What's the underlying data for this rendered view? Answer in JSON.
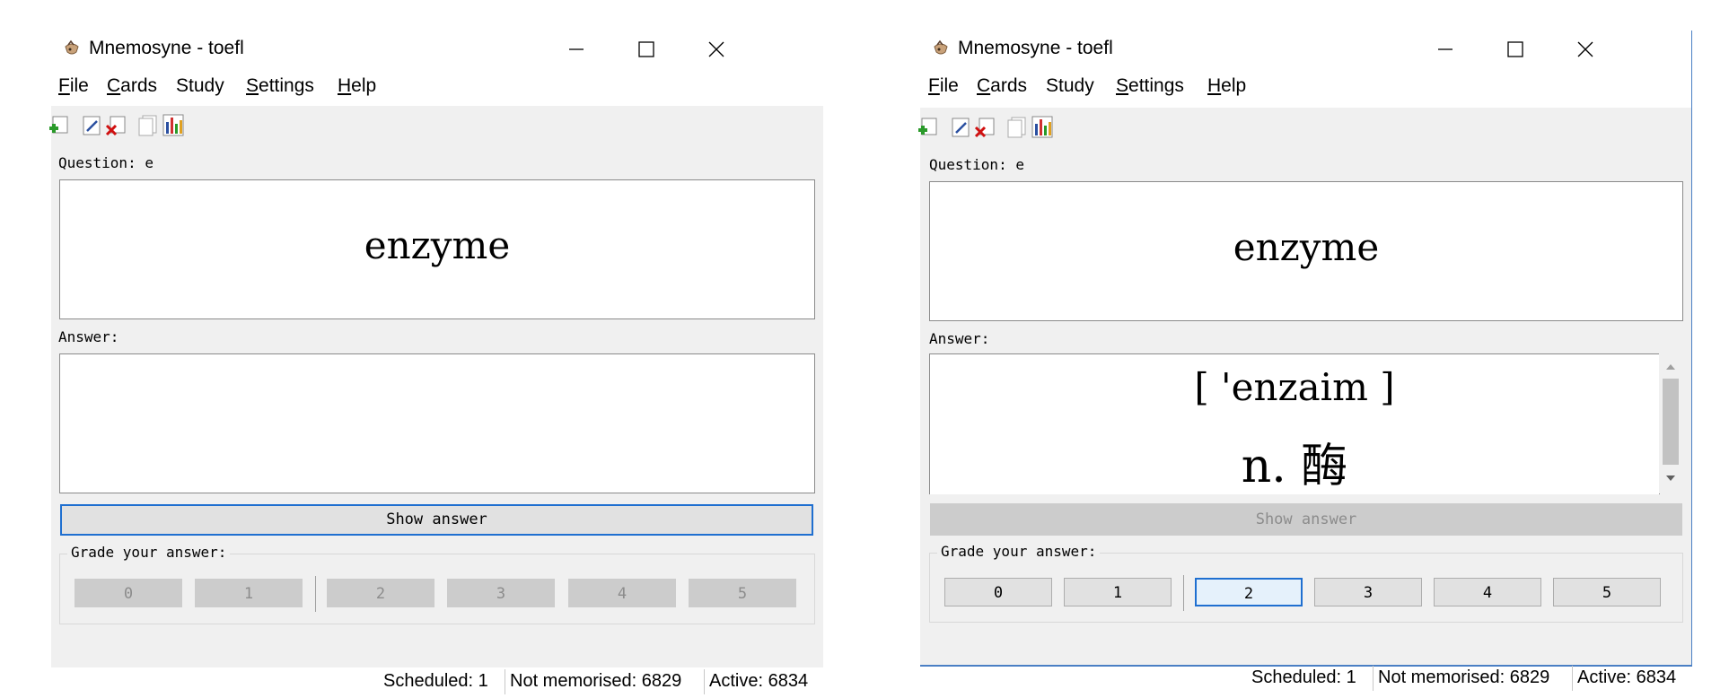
{
  "window_title": "Mnemosyne - toefl",
  "menu": {
    "file": {
      "accel": "F",
      "rest": "ile"
    },
    "cards": {
      "accel": "C",
      "rest": "ards"
    },
    "study": "Study",
    "settings": {
      "accel": "S",
      "rest": "ettings"
    },
    "help": {
      "accel": "H",
      "rest": "elp"
    }
  },
  "toolbar_icons": [
    "add-card-icon",
    "edit-card-icon",
    "delete-card-icon",
    "browse-cards-icon",
    "statistics-icon"
  ],
  "question_label": "Question: e",
  "question_text": "enzyme",
  "answer_label": "Answer:",
  "answer_pronunciation": "[ 'enzaim ]",
  "answer_definition": "n. 酶",
  "show_answer_label": "Show answer",
  "grade_legend": "Grade your answer:",
  "grades": [
    "0",
    "1",
    "2",
    "3",
    "4",
    "5"
  ],
  "status": {
    "scheduled": "Scheduled: 1",
    "not_memorised": "Not memorised: 6829",
    "active": "Active: 6834"
  },
  "colors": {
    "focus_blue": "#1f6fd0",
    "panel_gray": "#f0f0f0",
    "disabled_button": "#cccccc"
  }
}
